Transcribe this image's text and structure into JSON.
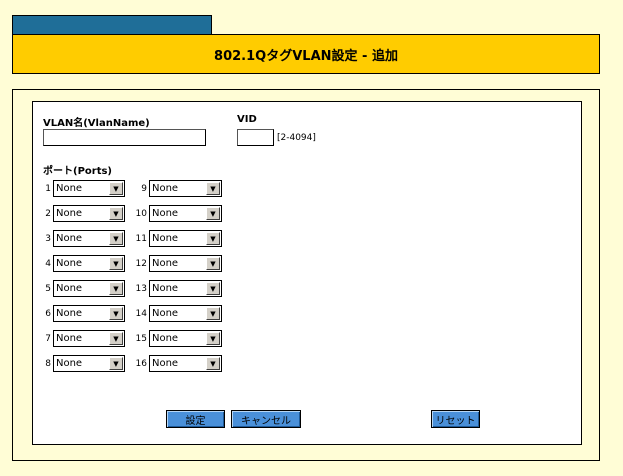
{
  "header": {
    "title": "802.1QタグVLAN設定 - 追加"
  },
  "form": {
    "vlan_name_label": "VLAN名(VlanName)",
    "vlan_name_value": "",
    "vid_label": "VID",
    "vid_value": "",
    "vid_range": "[2-4094]",
    "ports_label": "ポート(Ports)",
    "ports": [
      {
        "num": "1",
        "value": "None"
      },
      {
        "num": "2",
        "value": "None"
      },
      {
        "num": "3",
        "value": "None"
      },
      {
        "num": "4",
        "value": "None"
      },
      {
        "num": "5",
        "value": "None"
      },
      {
        "num": "6",
        "value": "None"
      },
      {
        "num": "7",
        "value": "None"
      },
      {
        "num": "8",
        "value": "None"
      },
      {
        "num": "9",
        "value": "None"
      },
      {
        "num": "10",
        "value": "None"
      },
      {
        "num": "11",
        "value": "None"
      },
      {
        "num": "12",
        "value": "None"
      },
      {
        "num": "13",
        "value": "None"
      },
      {
        "num": "14",
        "value": "None"
      },
      {
        "num": "15",
        "value": "None"
      },
      {
        "num": "16",
        "value": "None"
      }
    ]
  },
  "buttons": {
    "submit": "設定",
    "cancel": "キャンセル",
    "reset": "リセット"
  },
  "colors": {
    "background": "#fffdd6",
    "title_bar": "#ffcc00",
    "tab": "#1f6e98",
    "button": "#4a90d9"
  }
}
